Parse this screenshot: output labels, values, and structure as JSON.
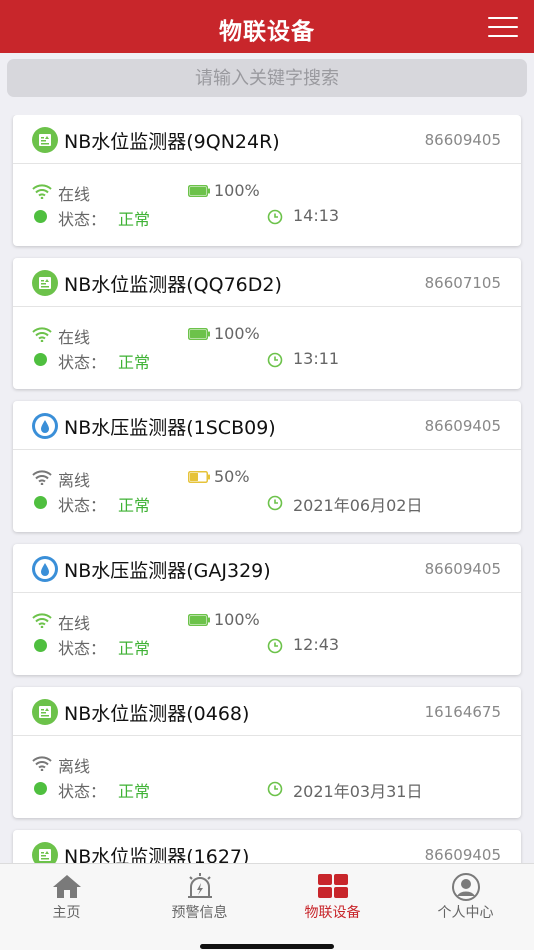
{
  "header": {
    "title": "物联设备"
  },
  "search": {
    "placeholder": "请输入关键字搜索"
  },
  "status_label": "状态：",
  "colors": {
    "accent": "#c8262b",
    "online": "#6cc24a",
    "offline": "#777777",
    "ok": "#3fb235"
  },
  "devices": [
    {
      "icon": "water-level-icon",
      "name": "NB水位监测器(9QN24R)",
      "number": "86609405",
      "connection": "在线",
      "battery": "100%",
      "battery_level": 1.0,
      "status": "正常",
      "time": "14:13"
    },
    {
      "icon": "water-level-icon",
      "name": "NB水位监测器(QQ76D2)",
      "number": "86607105",
      "connection": "在线",
      "battery": "100%",
      "battery_level": 1.0,
      "status": "正常",
      "time": "13:11"
    },
    {
      "icon": "water-pressure-icon",
      "name": "NB水压监测器(1SCB09)",
      "number": "86609405",
      "connection": "离线",
      "battery": "50%",
      "battery_level": 0.5,
      "status": "正常",
      "time": "2021年06月02日"
    },
    {
      "icon": "water-pressure-icon",
      "name": "NB水压监测器(GAJ329)",
      "number": "86609405",
      "connection": "在线",
      "battery": "100%",
      "battery_level": 1.0,
      "status": "正常",
      "time": "12:43"
    },
    {
      "icon": "water-level-icon",
      "name": "NB水位监测器(0468)",
      "number": "16164675",
      "connection": "离线",
      "battery": "",
      "battery_level": null,
      "status": "正常",
      "time": "2021年03月31日"
    },
    {
      "icon": "water-level-icon",
      "name": "NB水位监测器(1627)",
      "number": "86609405",
      "connection": "",
      "battery": "",
      "battery_level": null,
      "status": "",
      "time": ""
    }
  ],
  "tabbar": {
    "items": [
      {
        "label": "主页",
        "icon": "home-icon"
      },
      {
        "label": "预警信息",
        "icon": "alarm-icon"
      },
      {
        "label": "物联设备",
        "icon": "grid-icon"
      },
      {
        "label": "个人中心",
        "icon": "user-icon"
      }
    ],
    "active_index": 2
  }
}
